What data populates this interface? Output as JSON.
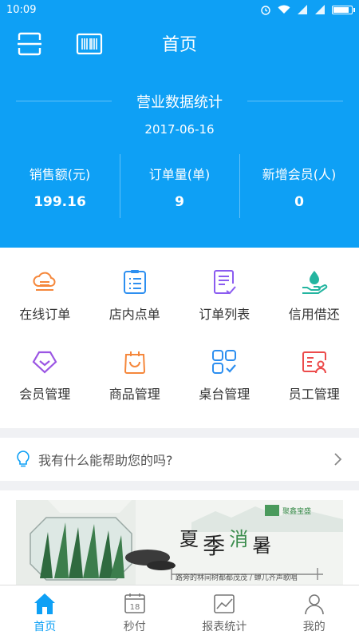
{
  "status": {
    "time": "10:09"
  },
  "header": {
    "title": "首页"
  },
  "stats": {
    "title": "营业数据统计",
    "date": "2017-06-16",
    "items": [
      {
        "label": "销售额(元)",
        "value": "199.16"
      },
      {
        "label": "订单量(单)",
        "value": "9"
      },
      {
        "label": "新增会员(人)",
        "value": "0"
      }
    ]
  },
  "grid": {
    "items": [
      {
        "label": "在线订单",
        "icon": "cloud-order-icon",
        "color": "#f5873b"
      },
      {
        "label": "店内点单",
        "icon": "clipboard-list-icon",
        "color": "#2d8ff0"
      },
      {
        "label": "订单列表",
        "icon": "order-list-icon",
        "color": "#8b5cf0"
      },
      {
        "label": "信用借还",
        "icon": "hand-drop-icon",
        "color": "#24b5a0"
      },
      {
        "label": "会员管理",
        "icon": "member-diamond-icon",
        "color": "#9b55e3"
      },
      {
        "label": "商品管理",
        "icon": "shopping-bag-icon",
        "color": "#f5873b"
      },
      {
        "label": "桌台管理",
        "icon": "table-grid-icon",
        "color": "#2d8ff0"
      },
      {
        "label": "员工管理",
        "icon": "staff-card-icon",
        "color": "#ec4b4b"
      }
    ]
  },
  "help": {
    "text": "我有什么能帮助您的吗?"
  },
  "banner": {
    "title_chars": [
      "夏",
      "季",
      "消",
      "暑"
    ],
    "subtitle": "路旁的林间树都都茂茂 / 蝉儿齐声歌唱",
    "brand": "聚鑫宝盛"
  },
  "tabs": [
    {
      "label": "首页",
      "active": true
    },
    {
      "label": "秒付",
      "badge": "18"
    },
    {
      "label": "报表统计"
    },
    {
      "label": "我的"
    }
  ],
  "colors": {
    "primary": "#0ea0f5"
  }
}
